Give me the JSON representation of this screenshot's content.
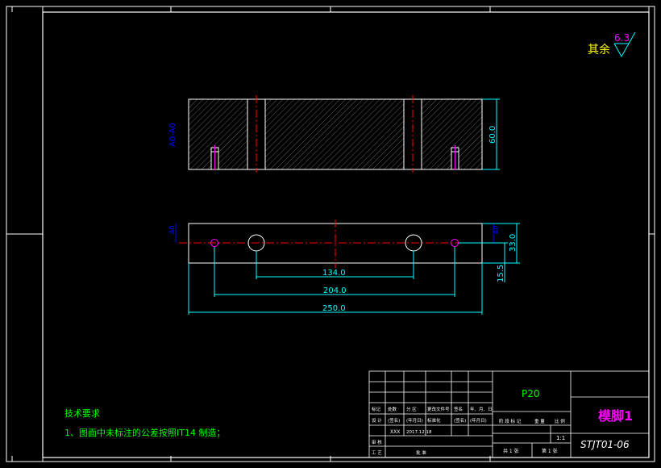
{
  "roughness": {
    "label": "其余",
    "value": "6.3"
  },
  "section_label": "A0-A0",
  "section_marks": {
    "left": "A0",
    "right": "A0"
  },
  "dimensions": {
    "height_top": "60.0",
    "length_134": "134.0",
    "length_204": "204.0",
    "length_250": "250.0",
    "width_33": "33.0",
    "offset_15": "15.5"
  },
  "tech_notes": {
    "title": "技术要求",
    "item_1": "1、图面中未标注的公差按照IT14 制造；"
  },
  "title_block": {
    "material": "P20",
    "part_name": "模脚1",
    "drawing_no": "STJT01-06",
    "scale": "1:1",
    "row_labels_a": [
      "标记",
      "处数",
      "分 区",
      "更改文件号",
      "签名",
      "年、月、日"
    ],
    "row_labels_b": [
      "设 计",
      "(签名)",
      "(年月日)",
      "标准化",
      "(签名)",
      "(年月日)"
    ],
    "designer": "XXX",
    "date": "2017.12.18",
    "review": "审 核",
    "process": "工 艺",
    "approve": "批 准",
    "stage_headers": [
      "阶 段 标 记",
      "重 量",
      "比 例"
    ],
    "sheets_total": "共  1  张",
    "sheet_num": "第  1  张"
  },
  "colors": {
    "frame": "#ffffff",
    "part": "#ffffff",
    "dimension": "#00ffff",
    "centerline": "#ff0000",
    "pin": "#ff00ff",
    "hatch": "#a0a0a0",
    "label_blue": "#0000ff",
    "notes": "#00ff00",
    "roughness": "#ffff00"
  }
}
